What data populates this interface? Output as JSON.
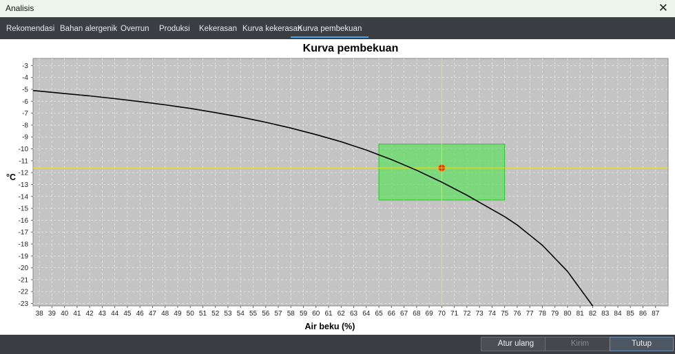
{
  "window": {
    "title": "Analisis",
    "close_icon": "close-icon"
  },
  "tabs": [
    {
      "label": "Rekomendasi"
    },
    {
      "label": "Bahan alergenik"
    },
    {
      "label": "Overrun"
    },
    {
      "label": "Produksi"
    },
    {
      "label": "Kekerasan"
    },
    {
      "label": "Kurva kekerasan"
    },
    {
      "label": "Kurva pembekuan",
      "active": true
    }
  ],
  "footer": {
    "reset_label": "Atur ulang",
    "send_label": "Kirim",
    "close_label": "Tutup"
  },
  "colors": {
    "plot_bg": "#c4c4c4",
    "curve": "#000000",
    "crosshair": "#f0e020",
    "highlight_fill": "#66dd66",
    "highlight_stroke": "#22cc22",
    "marker": "#cc3300"
  },
  "chart_data": {
    "type": "line",
    "title": "Kurva pembekuan",
    "xlabel": "Air beku (%)",
    "ylabel": "°C",
    "xlim": [
      37.5,
      88
    ],
    "ylim": [
      -23.2,
      -2.4
    ],
    "x_ticks": [
      38,
      39,
      40,
      41,
      42,
      43,
      44,
      45,
      46,
      47,
      48,
      49,
      50,
      51,
      52,
      53,
      54,
      55,
      56,
      57,
      58,
      59,
      60,
      61,
      62,
      63,
      64,
      65,
      66,
      67,
      68,
      69,
      70,
      71,
      72,
      73,
      74,
      75,
      76,
      77,
      78,
      79,
      80,
      81,
      82,
      83,
      84,
      85,
      86,
      87
    ],
    "y_ticks": [
      -3,
      -4,
      -5,
      -6,
      -7,
      -8,
      -9,
      -10,
      -11,
      -12,
      -13,
      -14,
      -15,
      -16,
      -17,
      -18,
      -19,
      -20,
      -21,
      -22,
      -23
    ],
    "grid": true,
    "series": [
      {
        "x": [
          37.5,
          40,
          42,
          44,
          46,
          48,
          50,
          52,
          54,
          56,
          58,
          60,
          62,
          64,
          65,
          66,
          68,
          70,
          72,
          74,
          75,
          76,
          78,
          80,
          82,
          83.2
        ],
        "y": [
          -5.1,
          -5.35,
          -5.55,
          -5.78,
          -6.03,
          -6.3,
          -6.6,
          -6.95,
          -7.33,
          -7.77,
          -8.25,
          -8.8,
          -9.4,
          -10.1,
          -10.5,
          -10.9,
          -11.8,
          -12.8,
          -13.9,
          -15.1,
          -15.7,
          -16.4,
          -18.1,
          -20.3,
          -23.2,
          -25.2
        ]
      }
    ],
    "highlight": {
      "x": [
        65,
        75
      ],
      "y": [
        -9.6,
        -14.3
      ]
    },
    "crosshair": {
      "x": 70,
      "y": -11.6
    },
    "marker": {
      "x": 70,
      "y": -11.6
    }
  }
}
